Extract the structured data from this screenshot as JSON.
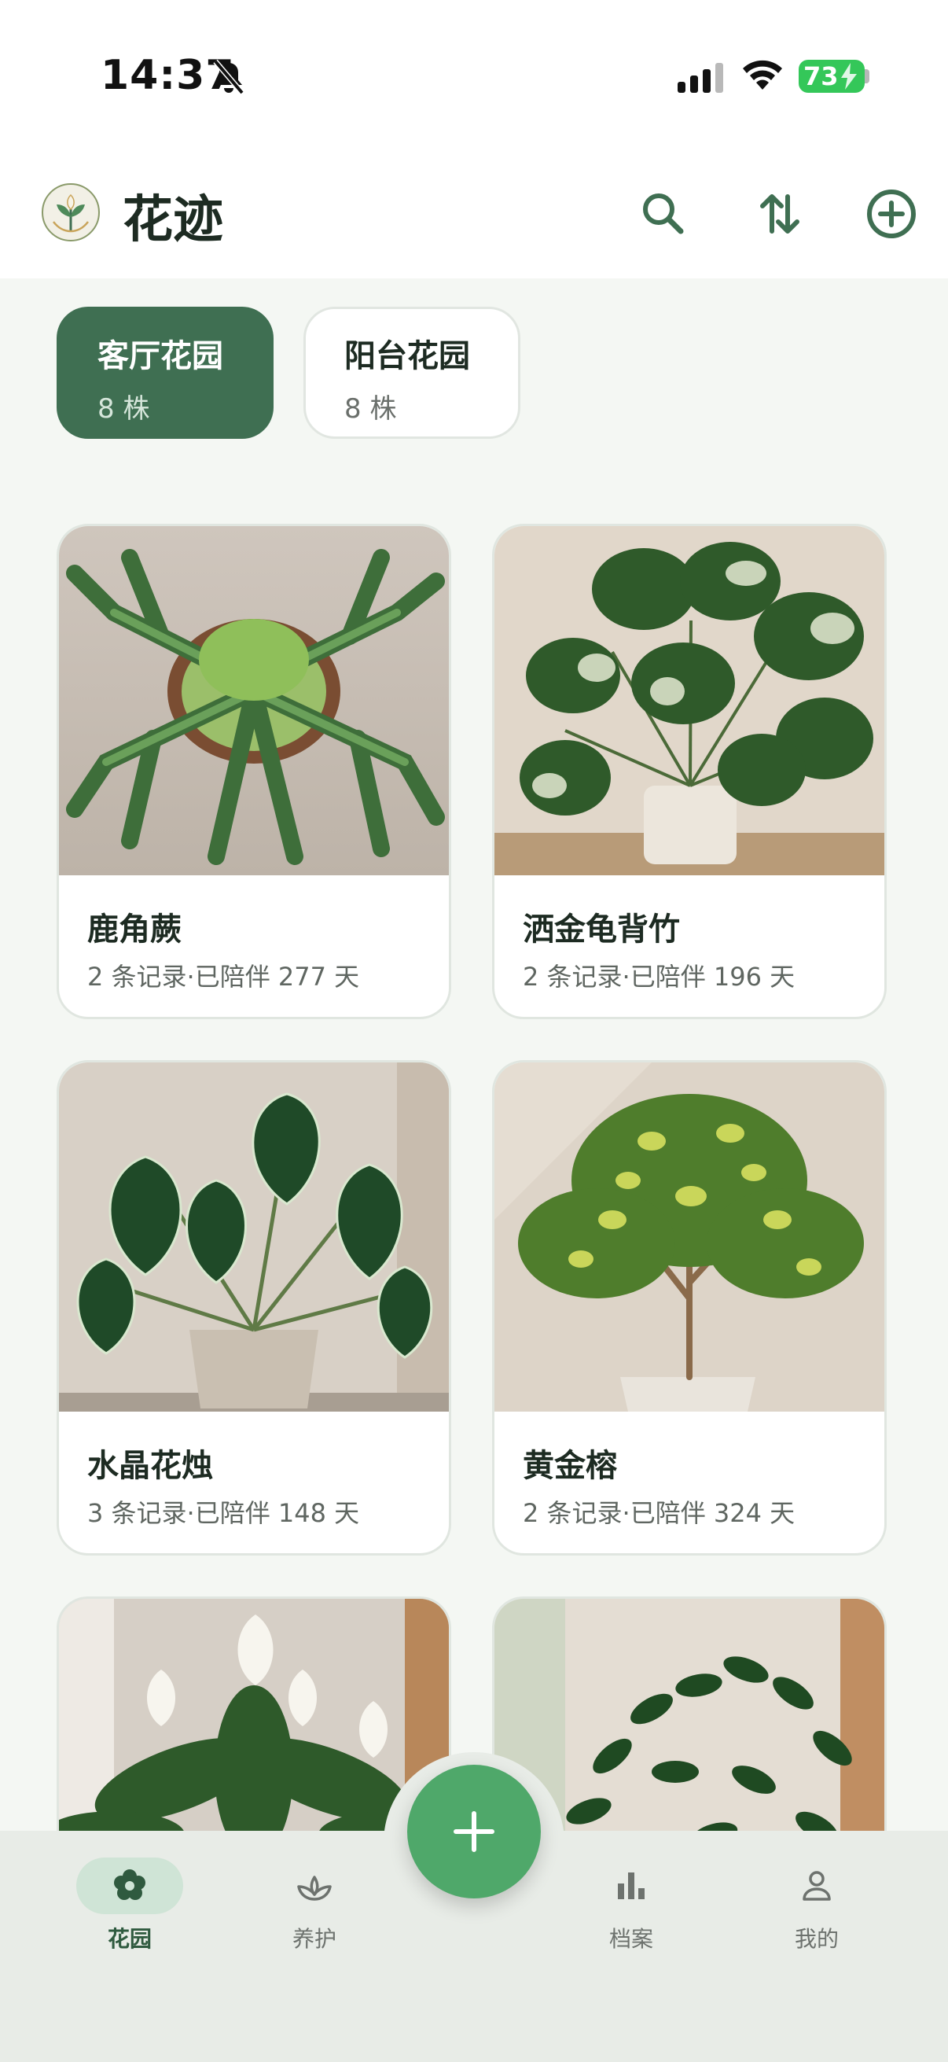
{
  "status_bar": {
    "time": "14:37",
    "battery_level": "73",
    "icons": [
      "bell-slash-icon",
      "signal-icon",
      "wifi-icon",
      "battery-charging-icon"
    ]
  },
  "header": {
    "title": "花迹",
    "logo_icon": "plant-logo-icon",
    "actions": [
      "search-icon",
      "sort-icon",
      "add-circle-icon"
    ],
    "accent_color": "#3f6f52"
  },
  "gardens": [
    {
      "name": "客厅花园",
      "count": "8 株",
      "selected": true
    },
    {
      "name": "阳台花园",
      "count": "8 株",
      "selected": false
    }
  ],
  "plants": [
    {
      "name": "鹿角蕨",
      "meta": "2 条记录·已陪伴 277 天"
    },
    {
      "name": "洒金龟背竹",
      "meta": "2 条记录·已陪伴 196 天"
    },
    {
      "name": "水晶花烛",
      "meta": "3 条记录·已陪伴 148 天"
    },
    {
      "name": "黄金榕",
      "meta": "2 条记录·已陪伴 324 天"
    }
  ],
  "bottom_nav": {
    "items": [
      {
        "label": "花园",
        "icon": "flower-icon",
        "active": true
      },
      {
        "label": "养护",
        "icon": "sprout-icon",
        "active": false
      },
      {
        "label": "档案",
        "icon": "bar-chart-icon",
        "active": false
      },
      {
        "label": "我的",
        "icon": "person-icon",
        "active": false
      }
    ],
    "fab_icon": "plus-icon",
    "fab_color": "#4fa86a"
  }
}
